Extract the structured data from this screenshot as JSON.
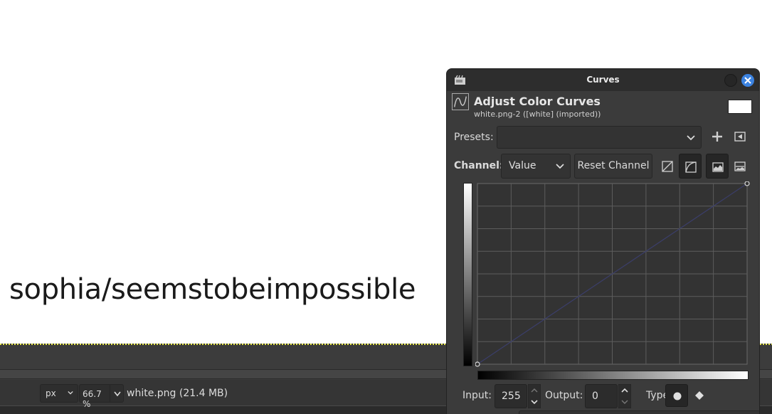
{
  "canvas": {
    "text": "sophia/seemstobeimpossible"
  },
  "statusbar": {
    "unit": "px",
    "zoom": "66.7 %",
    "file_info": "white.png (21.4 MB)"
  },
  "dialog": {
    "title": "Curves",
    "header_title": "Adjust Color Curves",
    "header_subtitle": "white.png-2 ([white] (imported))",
    "presets_label": "Presets:",
    "presets_value": "",
    "channel_label": "Channel:",
    "channel_value": "Value",
    "reset_channel_label": "Reset Channel",
    "input_label": "Input:",
    "input_value": "255",
    "output_label": "Output:",
    "output_value": "0",
    "type_label": "Type:",
    "curve_points": [
      [
        0,
        0
      ],
      [
        255,
        255
      ]
    ],
    "icons": {
      "app": "gimp-icon",
      "header": "curves-icon",
      "add_preset": "plus-icon",
      "preset_menu": "triangle-left-menu-icon",
      "linear_histogram": "linear-histogram-icon",
      "log_histogram": "logarithmic-histogram-icon",
      "histogram_a": "histogram-icon",
      "histogram_b": "histogram-alt-icon",
      "type_smooth": "smooth-point-icon",
      "type_corner": "corner-point-icon",
      "close": "close-icon"
    },
    "colors": {
      "accent_close": "#3b82e0",
      "curve_line": "#3b3e6a",
      "background": "#3b3b3b"
    }
  }
}
